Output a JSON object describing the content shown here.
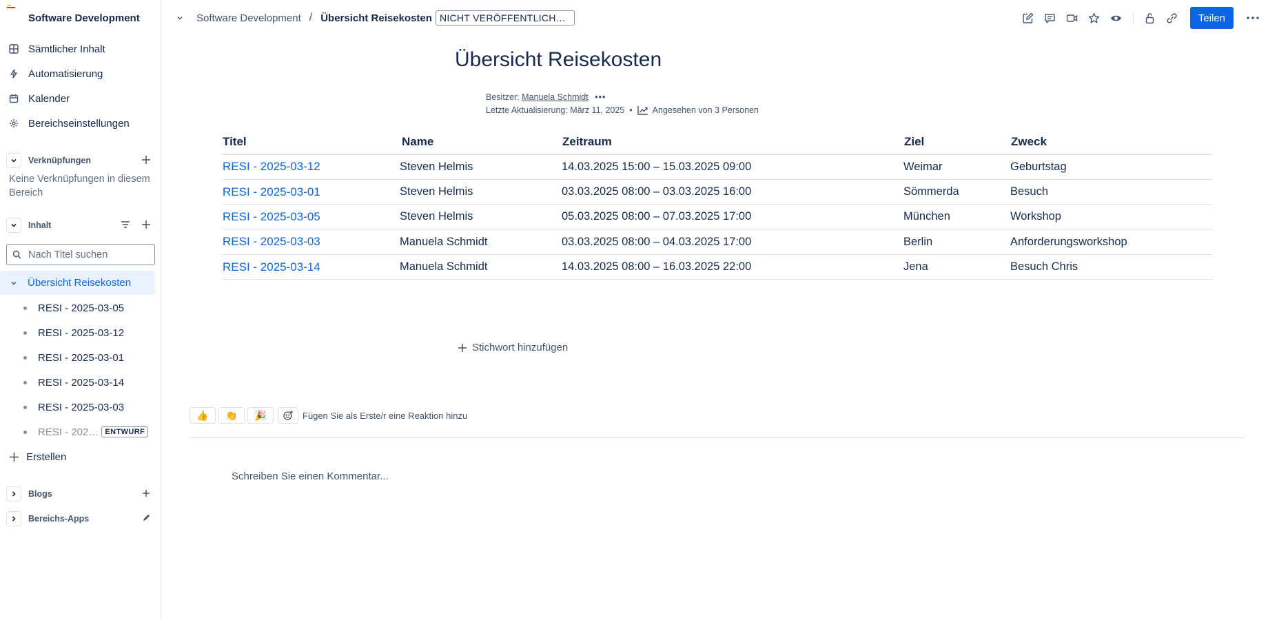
{
  "sidebar": {
    "space_name": "Software Development",
    "nav": [
      {
        "label": "Sämtlicher Inhalt",
        "icon": "grid-icon"
      },
      {
        "label": "Automatisierung",
        "icon": "lightning-icon"
      },
      {
        "label": "Kalender",
        "icon": "calendar-icon"
      },
      {
        "label": "Bereichseinstellungen",
        "icon": "gear-icon"
      }
    ],
    "shortcuts_label": "Verknüpfungen",
    "no_shortcuts": "Keine Verknüpfungen in diesem Bereich",
    "content_label": "Inhalt",
    "search_placeholder": "Nach Titel suchen",
    "tree_active": "Übersicht Reisekosten",
    "tree_items": [
      "RESI - 2025-03-05",
      "RESI - 2025-03-12",
      "RESI - 2025-03-01",
      "RESI - 2025-03-14",
      "RESI - 2025-03-03",
      "RESI - 202…"
    ],
    "draft_badge": "ENTWURF",
    "create_label": "Erstellen",
    "blogs_label": "Blogs",
    "apps_label": "Bereichs-Apps"
  },
  "topbar": {
    "breadcrumb_space": "Software Development",
    "separator": "/",
    "current_page": "Übersicht Reisekosten",
    "status": "NICHT VERÖFFENTLICHTE…",
    "share_label": "Teilen"
  },
  "page": {
    "title": "Übersicht Reisekosten",
    "owner_label": "Besitzer:",
    "owner_name": "Manuela Schmidt",
    "owner_more": "•••",
    "updated": "Letzte Aktualisierung: März 11, 2025",
    "bullet": "•",
    "viewed": "Angesehen von 3 Personen",
    "add_label": "Stichwort hinzufügen",
    "reaction_prompt": "Fügen Sie als Erste/r eine Reaktion hinzu",
    "reactions": [
      "👍",
      "👏",
      "🎉"
    ],
    "comment_placeholder": "Schreiben Sie einen Kommentar..."
  },
  "table": {
    "headers": [
      "Titel",
      "Name",
      "Zeitraum",
      "Ziel",
      "Zweck"
    ],
    "rows": [
      [
        "RESI - 2025-03-12",
        "Steven Helmis",
        "14.03.2025 15:00 – 15.03.2025 09:00",
        "Weimar",
        "Geburtstag"
      ],
      [
        "RESI - 2025-03-01",
        "Steven Helmis",
        "03.03.2025 08:00 – 03.03.2025 16:00",
        "Sömmerda",
        "Besuch"
      ],
      [
        "RESI - 2025-03-05",
        "Steven Helmis",
        "05.03.2025 08:00 – 07.03.2025 17:00",
        "München",
        "Workshop"
      ],
      [
        "RESI - 2025-03-03",
        "Manuela Schmidt",
        "03.03.2025 08:00 – 04.03.2025 17:00",
        "Berlin",
        "Anforderungsworkshop"
      ],
      [
        "RESI - 2025-03-14",
        "Manuela Schmidt",
        "14.03.2025 08:00 – 16.03.2025 22:00",
        "Jena",
        "Besuch Chris"
      ]
    ]
  },
  "colors": {
    "accent": "#0c66e4",
    "text": "#172b4d",
    "subtle": "#44546f",
    "border": "#dfe1e6",
    "active_bg": "#e9f2ff"
  }
}
